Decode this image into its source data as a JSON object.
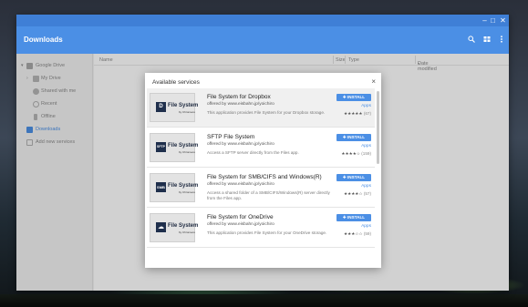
{
  "window": {
    "title": "Downloads",
    "controls": {
      "minimize": "–",
      "maximize": "□",
      "close": "✕"
    }
  },
  "header": {
    "title": "Downloads",
    "icons": [
      "search-icon",
      "view-grid-icon",
      "more-vert-icon"
    ]
  },
  "sidebar": {
    "items": [
      {
        "label": "Google Drive",
        "icon": "drive-icon"
      },
      {
        "label": "My Drive",
        "icon": "folder-icon"
      },
      {
        "label": "Shared with me",
        "icon": "people-icon"
      },
      {
        "label": "Recent",
        "icon": "clock-icon"
      },
      {
        "label": "Offline",
        "icon": "pin-icon"
      },
      {
        "label": "Downloads",
        "icon": "download-icon"
      },
      {
        "label": "Add new services",
        "icon": "add-icon"
      }
    ]
  },
  "columns": {
    "name": "Name",
    "size": "Size",
    "type": "Type",
    "date": "Date modified"
  },
  "dialog": {
    "title": "Available services",
    "close": "×",
    "install_label": "INSTALL",
    "apps_label": "Apps",
    "services": [
      {
        "name": "File System for Dropbox",
        "offered_by": "offered by www.eisbahn.jp/yoichiro",
        "description": "This application provides File System for your Dropbox storage.",
        "logo_text": "File System",
        "logo_glyph": "D",
        "logo_sub": "by Chromeos",
        "stars": "★★★★★",
        "count": "(67)"
      },
      {
        "name": "SFTP File System",
        "offered_by": "offered by www.eisbahn.jp/yoichiro",
        "description": "Access a SFTP server directly from the Files app.",
        "logo_text": "File System",
        "logo_glyph": "SFTP",
        "logo_sub": "by Chromeos",
        "stars": "★★★★☆",
        "count": "(159)"
      },
      {
        "name": "File System for SMB/CIFS and Windows(R)",
        "offered_by": "offered by www.eisbahn.jp/yoichiro",
        "description": "Access a shared folder of a SMB/CIFS/Windows(R) server directly from the Files app.",
        "logo_text": "File System",
        "logo_glyph": "SMB",
        "logo_sub": "by Chromeos",
        "stars": "★★★★☆",
        "count": "(57)"
      },
      {
        "name": "File System for OneDrive",
        "offered_by": "offered by www.eisbahn.jp/yoichiro",
        "description": "This application provides File System for your OneDrive storage.",
        "logo_text": "File System",
        "logo_glyph": "☁",
        "logo_sub": "by Chromeos",
        "stars": "★★★☆☆",
        "count": "(59)"
      }
    ]
  },
  "colors": {
    "accent": "#4b8fe5",
    "titlebar": "#3f7fd6"
  }
}
